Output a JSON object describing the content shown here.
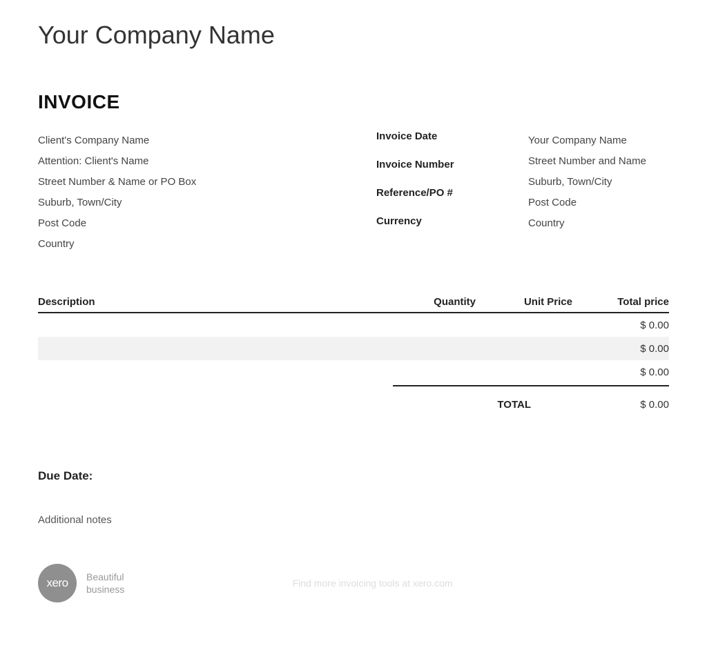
{
  "header": {
    "company_name": "Your Company Name",
    "invoice_title": "INVOICE"
  },
  "client": {
    "company": "Client's Company Name",
    "attention": "Attention: Client's Name",
    "street": "Street Number & Name or PO Box",
    "suburb": "Suburb, Town/City",
    "postcode": "Post Code",
    "country": "Country"
  },
  "meta": {
    "date_label": "Invoice Date",
    "number_label": "Invoice Number",
    "ref_label": "Reference/PO #",
    "currency_label": "Currency"
  },
  "vendor": {
    "name": "Your Company Name",
    "street": "Street Number and Name",
    "suburb": "Suburb, Town/City",
    "postcode": "Post Code",
    "country": "Country"
  },
  "table": {
    "headers": {
      "description": "Description",
      "quantity": "Quantity",
      "unit_price": "Unit Price",
      "total_price": "Total price"
    },
    "rows": [
      {
        "desc": "",
        "qty": "",
        "unit": "",
        "total": "$ 0.00"
      },
      {
        "desc": "",
        "qty": "",
        "unit": "",
        "total": "$ 0.00"
      },
      {
        "desc": "",
        "qty": "",
        "unit": "",
        "total": "$ 0.00"
      }
    ],
    "total_label": "TOTAL",
    "total_value": "$ 0.00"
  },
  "footer_fields": {
    "due_date_label": "Due Date:",
    "notes_label": "Additional notes"
  },
  "footer": {
    "logo_text": "xero",
    "tagline_line1": "Beautiful",
    "tagline_line2": "business",
    "center_text": "Find more invoicing tools at xero.com"
  }
}
